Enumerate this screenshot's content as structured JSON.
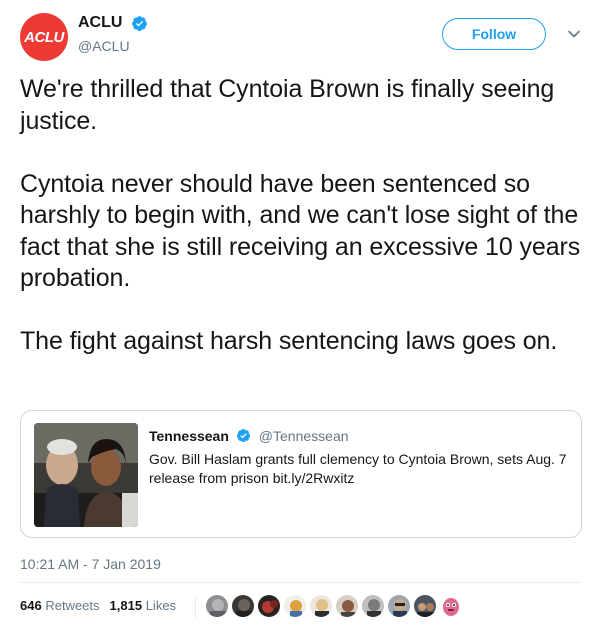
{
  "author": {
    "avatar_text": "ACLU",
    "display_name": "ACLU",
    "handle": "@ACLU",
    "avatar_color": "#ee3a35"
  },
  "actions": {
    "follow_label": "Follow"
  },
  "tweet": {
    "text": "We're thrilled that Cyntoia Brown is finally seeing justice.\n\nCyntoia never should have been sentenced so harshly to begin with, and we can't lose sight of the fact that she is still receiving an excessive 10 years probation.\n\nThe fight against harsh sentencing laws goes on.",
    "timestamp": "10:21 AM - 7 Jan 2019"
  },
  "quote": {
    "author": "Tennessean",
    "handle": "@Tennessean",
    "text": "Gov. Bill Haslam grants full clemency to Cyntoia Brown, sets Aug. 7 release from prison bit.ly/2Rwxitz"
  },
  "stats": {
    "retweets_count": "646",
    "retweets_label": "Retweets",
    "likes_count": "1,815",
    "likes_label": "Likes"
  },
  "colors": {
    "link_blue": "#1da1f2",
    "secondary_text": "#657786",
    "border": "#ccd6dd"
  },
  "likers": [
    "gray-avatar",
    "dark-avatar",
    "red-avatar",
    "cartoon-avatar",
    "blond-avatar",
    "woman-avatar",
    "man-avatar",
    "glasses-avatar",
    "group-avatar",
    "pink-monster-avatar"
  ]
}
